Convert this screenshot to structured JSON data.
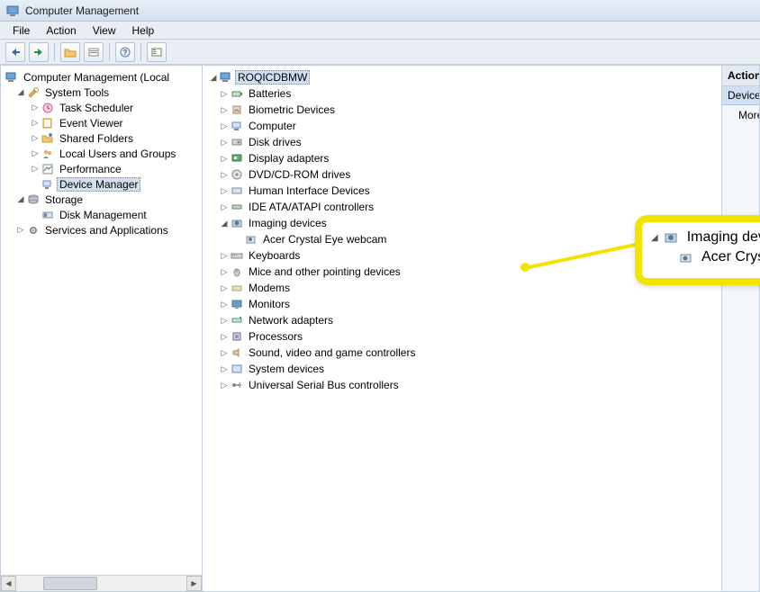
{
  "titlebar": {
    "title": "Computer Management"
  },
  "menubar": {
    "items": [
      "File",
      "Action",
      "View",
      "Help"
    ]
  },
  "left_tree": {
    "root": "Computer Management (Local",
    "system_tools": {
      "label": "System Tools",
      "children": [
        "Task Scheduler",
        "Event Viewer",
        "Shared Folders",
        "Local Users and Groups",
        "Performance",
        "Device Manager"
      ]
    },
    "storage": {
      "label": "Storage",
      "children": [
        "Disk Management"
      ]
    },
    "services": {
      "label": "Services and Applications"
    }
  },
  "device_tree": {
    "root": "ROQICDBMW",
    "categories": [
      "Batteries",
      "Biometric Devices",
      "Computer",
      "Disk drives",
      "Display adapters",
      "DVD/CD-ROM drives",
      "Human Interface Devices",
      "IDE ATA/ATAPI controllers",
      "Imaging devices",
      "Keyboards",
      "Mice and other pointing devices",
      "Modems",
      "Monitors",
      "Network adapters",
      "Processors",
      "Sound, video and game controllers",
      "System devices",
      "Universal Serial Bus controllers"
    ],
    "imaging_child": "Acer Crystal Eye webcam"
  },
  "callout": {
    "line1": "Imaging devices",
    "line2": "Acer Crystal Eye webcam"
  },
  "actions": {
    "header": "Actions",
    "selected": "Device Manager",
    "more": "More Actions"
  }
}
